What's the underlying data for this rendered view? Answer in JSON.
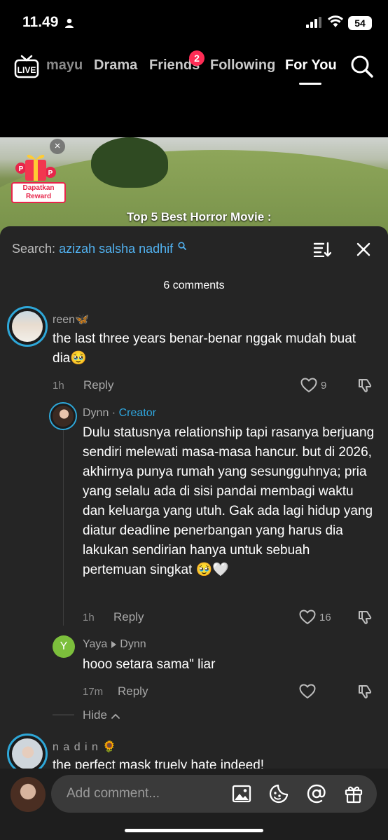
{
  "status_bar": {
    "time": "11.49",
    "battery": "54"
  },
  "nav": {
    "tabs": [
      {
        "label": "mayu"
      },
      {
        "label": "Drama"
      },
      {
        "label": "Friends",
        "badge": "2"
      },
      {
        "label": "Following"
      },
      {
        "label": "For You",
        "active": true
      }
    ]
  },
  "video": {
    "overlay_text": "Top 5 Best Horror Movie :",
    "reward_label": "Dapatkan Reward",
    "close_glyph": "×"
  },
  "comments_sheet": {
    "search_prefix": "Search:",
    "search_term": "azizah salsha nadhif",
    "count_label": "6 comments",
    "hide_label": "Hide",
    "comments": [
      {
        "username": "reen🦋",
        "text": "the last three years benar-benar nggak mudah buat dia🥹",
        "time": "1h",
        "reply_label": "Reply",
        "likes": "9"
      },
      {
        "username": "Dynn",
        "creator_separator": " · ",
        "creator_tag": "Creator",
        "text": "Dulu statusnya relationship tapi rasanya berjuang sendiri melewati masa-masa hancur. but di 2026, akhirnya punya rumah yang sesungguhnya; pria yang selalu ada di sisi pandai membagi waktu dan keluarga yang utuh. Gak ada lagi hidup yang diatur deadline penerbangan yang harus dia lakukan sendirian hanya untuk sebuah pertemuan singkat 🥹🤍",
        "time": "1h",
        "reply_label": "Reply",
        "likes": "16"
      },
      {
        "username": "Yaya",
        "reply_to": "Dynn",
        "avatar_letter": "Y",
        "text": "hooo setara sama\" liar",
        "time": "17m",
        "reply_label": "Reply"
      },
      {
        "username": "n a d i n 🌻",
        "text": "the perfect mask truely hate indeed!"
      }
    ]
  },
  "bottom_bar": {
    "placeholder": "Add comment..."
  },
  "colors": {
    "accent_blue": "#2fa6de",
    "badge_red": "#fe2c55",
    "sheet_bg": "#252525"
  }
}
